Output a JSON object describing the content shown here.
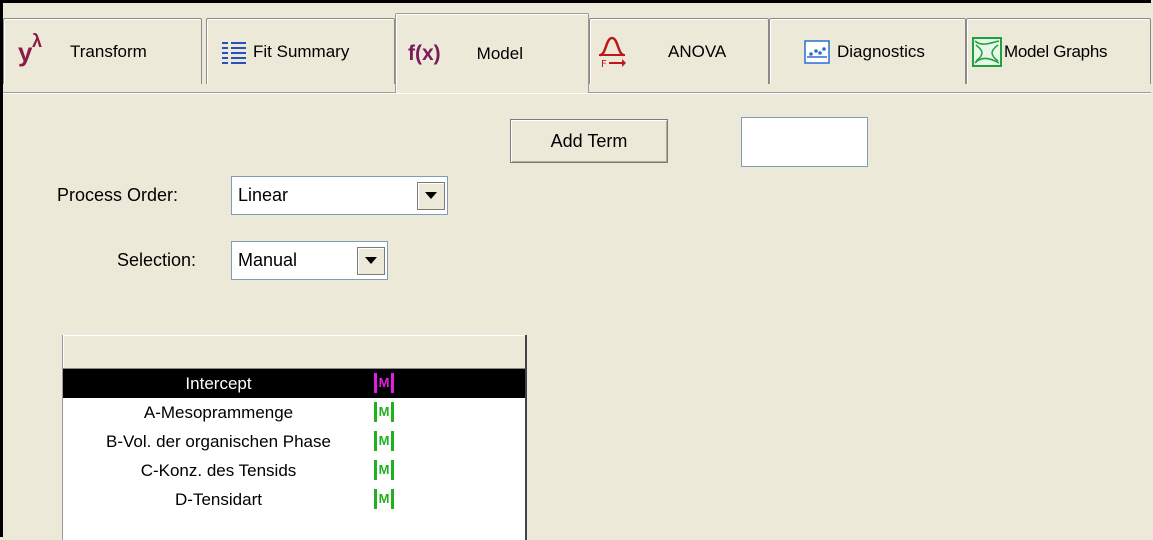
{
  "tabs": [
    {
      "label": "Transform",
      "icon": "y-lambda-icon",
      "icon_text": "y",
      "icon_sup": "λ"
    },
    {
      "label": "Fit Summary",
      "icon": "table-list-icon"
    },
    {
      "label": "Model",
      "icon": "fx-icon",
      "icon_text": "f(x)",
      "active": true
    },
    {
      "label": "ANOVA",
      "icon": "f-distribution-icon",
      "icon_text": "F→"
    },
    {
      "label": "Diagnostics",
      "icon": "scatter-plot-icon"
    },
    {
      "label": "Model Graphs",
      "icon": "contour-plot-icon"
    }
  ],
  "model": {
    "add_term_label": "Add Term",
    "add_term_value": "",
    "process_order_label": "Process Order:",
    "process_order_value": "Linear",
    "selection_label": "Selection:",
    "selection_value": "Manual"
  },
  "terms": [
    {
      "name": "Intercept",
      "marker": "M",
      "marker_color": "#e020e0",
      "selected": true
    },
    {
      "name": "A-Mesoprammenge",
      "marker": "M",
      "marker_color": "#20b020"
    },
    {
      "name": "B-Vol. der organischen Phase",
      "marker": "M",
      "marker_color": "#20b020"
    },
    {
      "name": "C-Konz. des Tensids",
      "marker": "M",
      "marker_color": "#20b020"
    },
    {
      "name": "D-Tensidart",
      "marker": "M",
      "marker_color": "#20b020"
    }
  ],
  "colors": {
    "background": "#ece9d8",
    "transform_icon": "#8b1a4a",
    "fx_icon": "#7a1c5a",
    "anova_icon": "#c01818",
    "fit_summary_icon": "#2850c0",
    "diagnostics_icon": "#2a6ed0",
    "model_graphs_icon": "#20a040"
  }
}
